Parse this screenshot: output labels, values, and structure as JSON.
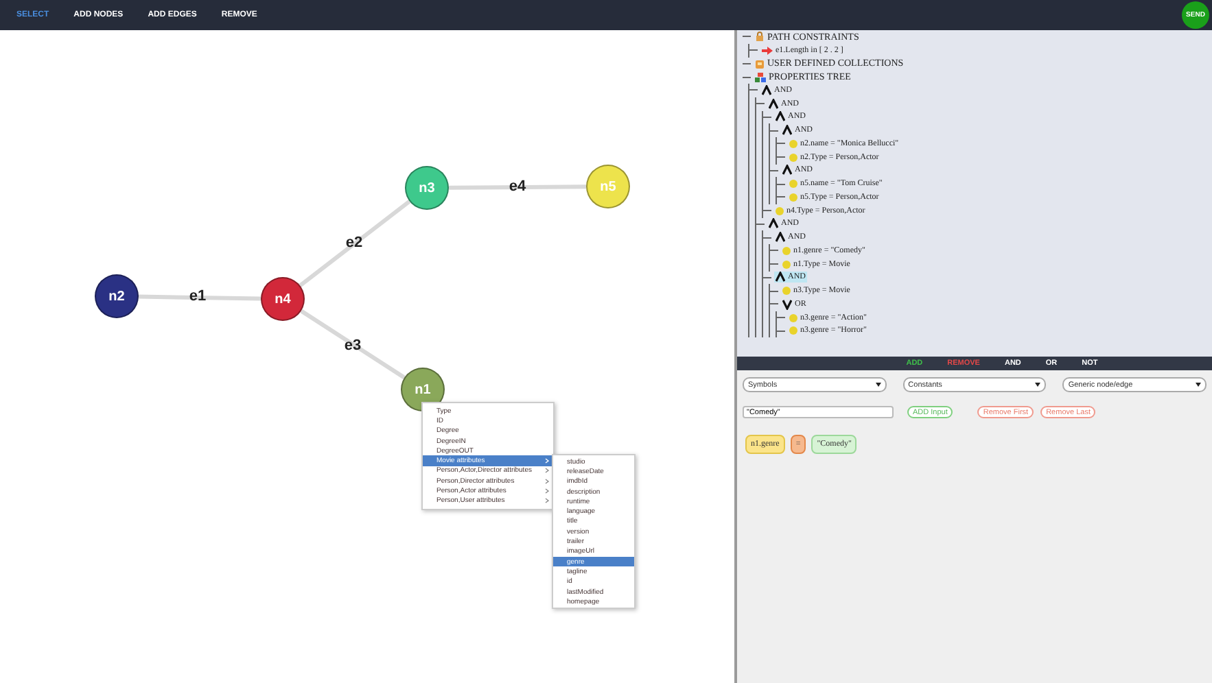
{
  "toolbar": {
    "items": [
      {
        "label": "SELECT",
        "selected": true
      },
      {
        "label": "ADD NODES",
        "selected": false
      },
      {
        "label": "ADD EDGES",
        "selected": false
      },
      {
        "label": "REMOVE",
        "selected": false
      }
    ],
    "send_button": "SEND"
  },
  "graph": {
    "nodes": [
      {
        "label": "n2",
        "color": "#2a3184"
      },
      {
        "label": "n4",
        "color": "#d2283a"
      },
      {
        "label": "n3",
        "color": "#3ec98c"
      },
      {
        "label": "n5",
        "color": "#ede34c"
      },
      {
        "label": "n1",
        "color": "#8aa85a"
      }
    ],
    "edges": [
      {
        "label": "e1"
      },
      {
        "label": "e2"
      },
      {
        "label": "e4"
      },
      {
        "label": "e3"
      }
    ]
  },
  "context_menu": {
    "items": [
      {
        "label": "Type",
        "submenu": false,
        "selected": false
      },
      {
        "label": "ID",
        "submenu": false,
        "selected": false
      },
      {
        "label": "Degree",
        "submenu": false,
        "selected": false
      },
      {
        "label": "DegreeIN",
        "submenu": false,
        "selected": false
      },
      {
        "label": "DegreeOUT",
        "submenu": false,
        "selected": false
      },
      {
        "label": "Movie attributes",
        "submenu": true,
        "selected": true
      },
      {
        "label": "Person,Actor,Director attributes",
        "submenu": true,
        "selected": false
      },
      {
        "label": "Person,Director attributes",
        "submenu": true,
        "selected": false
      },
      {
        "label": "Person,Actor attributes",
        "submenu": true,
        "selected": false
      },
      {
        "label": "Person,User attributes",
        "submenu": true,
        "selected": false
      }
    ],
    "submenu": [
      {
        "label": "studio",
        "selected": false
      },
      {
        "label": "releaseDate",
        "selected": false
      },
      {
        "label": "imdbId",
        "selected": false
      },
      {
        "label": "description",
        "selected": false
      },
      {
        "label": "runtime",
        "selected": false
      },
      {
        "label": "language",
        "selected": false
      },
      {
        "label": "title",
        "selected": false
      },
      {
        "label": "version",
        "selected": false
      },
      {
        "label": "trailer",
        "selected": false
      },
      {
        "label": "imageUrl",
        "selected": false
      },
      {
        "label": "genre",
        "selected": true
      },
      {
        "label": "tagline",
        "selected": false
      },
      {
        "label": "id",
        "selected": false
      },
      {
        "label": "lastModified",
        "selected": false
      },
      {
        "label": "homepage",
        "selected": false
      }
    ]
  },
  "tree": [
    {
      "kind": "path",
      "label": "PATH CONSTRAINTS",
      "selected": false,
      "children": [
        {
          "kind": "arrow",
          "label": "e1.Length in [ 2 . 2 ]",
          "selected": false
        }
      ]
    },
    {
      "kind": "collection",
      "label": "USER DEFINED COLLECTIONS",
      "selected": false
    },
    {
      "kind": "properties",
      "label": "PROPERTIES TREE",
      "selected": false,
      "children": [
        {
          "kind": "and",
          "label": "AND",
          "selected": false,
          "children": [
            {
              "kind": "and",
              "label": "AND",
              "selected": false,
              "children": [
                {
                  "kind": "and",
                  "label": "AND",
                  "selected": false,
                  "children": [
                    {
                      "kind": "and",
                      "label": "AND",
                      "selected": false,
                      "children": [
                        {
                          "kind": "leaf",
                          "label": "n2.name = \"Monica Bellucci\"",
                          "selected": false
                        },
                        {
                          "kind": "leaf",
                          "label": "n2.Type = Person,Actor",
                          "selected": false
                        }
                      ]
                    },
                    {
                      "kind": "and",
                      "label": "AND",
                      "selected": false,
                      "children": [
                        {
                          "kind": "leaf",
                          "label": "n5.name = \"Tom Cruise\"",
                          "selected": false
                        },
                        {
                          "kind": "leaf",
                          "label": "n5.Type = Person,Actor",
                          "selected": false
                        }
                      ]
                    }
                  ]
                },
                {
                  "kind": "leaf",
                  "label": "n4.Type = Person,Actor",
                  "selected": false
                }
              ]
            },
            {
              "kind": "and",
              "label": "AND",
              "selected": false,
              "children": [
                {
                  "kind": "and",
                  "label": "AND",
                  "selected": false,
                  "children": [
                    {
                      "kind": "leaf",
                      "label": "n1.genre = \"Comedy\"",
                      "selected": false
                    },
                    {
                      "kind": "leaf",
                      "label": "n1.Type = Movie",
                      "selected": false
                    }
                  ]
                },
                {
                  "kind": "and",
                  "label": "AND",
                  "selected": true,
                  "children": [
                    {
                      "kind": "leaf",
                      "label": "n3.Type = Movie",
                      "selected": false
                    },
                    {
                      "kind": "or",
                      "label": "OR",
                      "selected": false,
                      "children": [
                        {
                          "kind": "leaf",
                          "label": "n3.genre = \"Action\"",
                          "selected": false
                        },
                        {
                          "kind": "leaf",
                          "label": "n3.genre = \"Horror\"",
                          "selected": false
                        }
                      ]
                    }
                  ]
                }
              ]
            }
          ]
        }
      ]
    }
  ],
  "editor_toolbar": [
    {
      "kind": "add",
      "label": "ADD"
    },
    {
      "kind": "remove",
      "label": "REMOVE"
    },
    {
      "kind": "plain",
      "label": "AND"
    },
    {
      "kind": "plain",
      "label": "OR"
    },
    {
      "kind": "plain",
      "label": "NOT"
    }
  ],
  "selects": [
    "Symbols",
    "Constants",
    "Generic node/edge"
  ],
  "constant_input": {
    "value": "\"Comedy\""
  },
  "buttons": [
    {
      "kind": "add",
      "label": "ADD Input"
    },
    {
      "kind": "remove",
      "label": "Remove First"
    },
    {
      "kind": "remove",
      "label": "Remove Last"
    }
  ],
  "expression": [
    {
      "kind": "symbol",
      "label": "n1.genre"
    },
    {
      "kind": "operator",
      "label": "="
    },
    {
      "kind": "constant",
      "label": "\"Comedy\""
    }
  ]
}
